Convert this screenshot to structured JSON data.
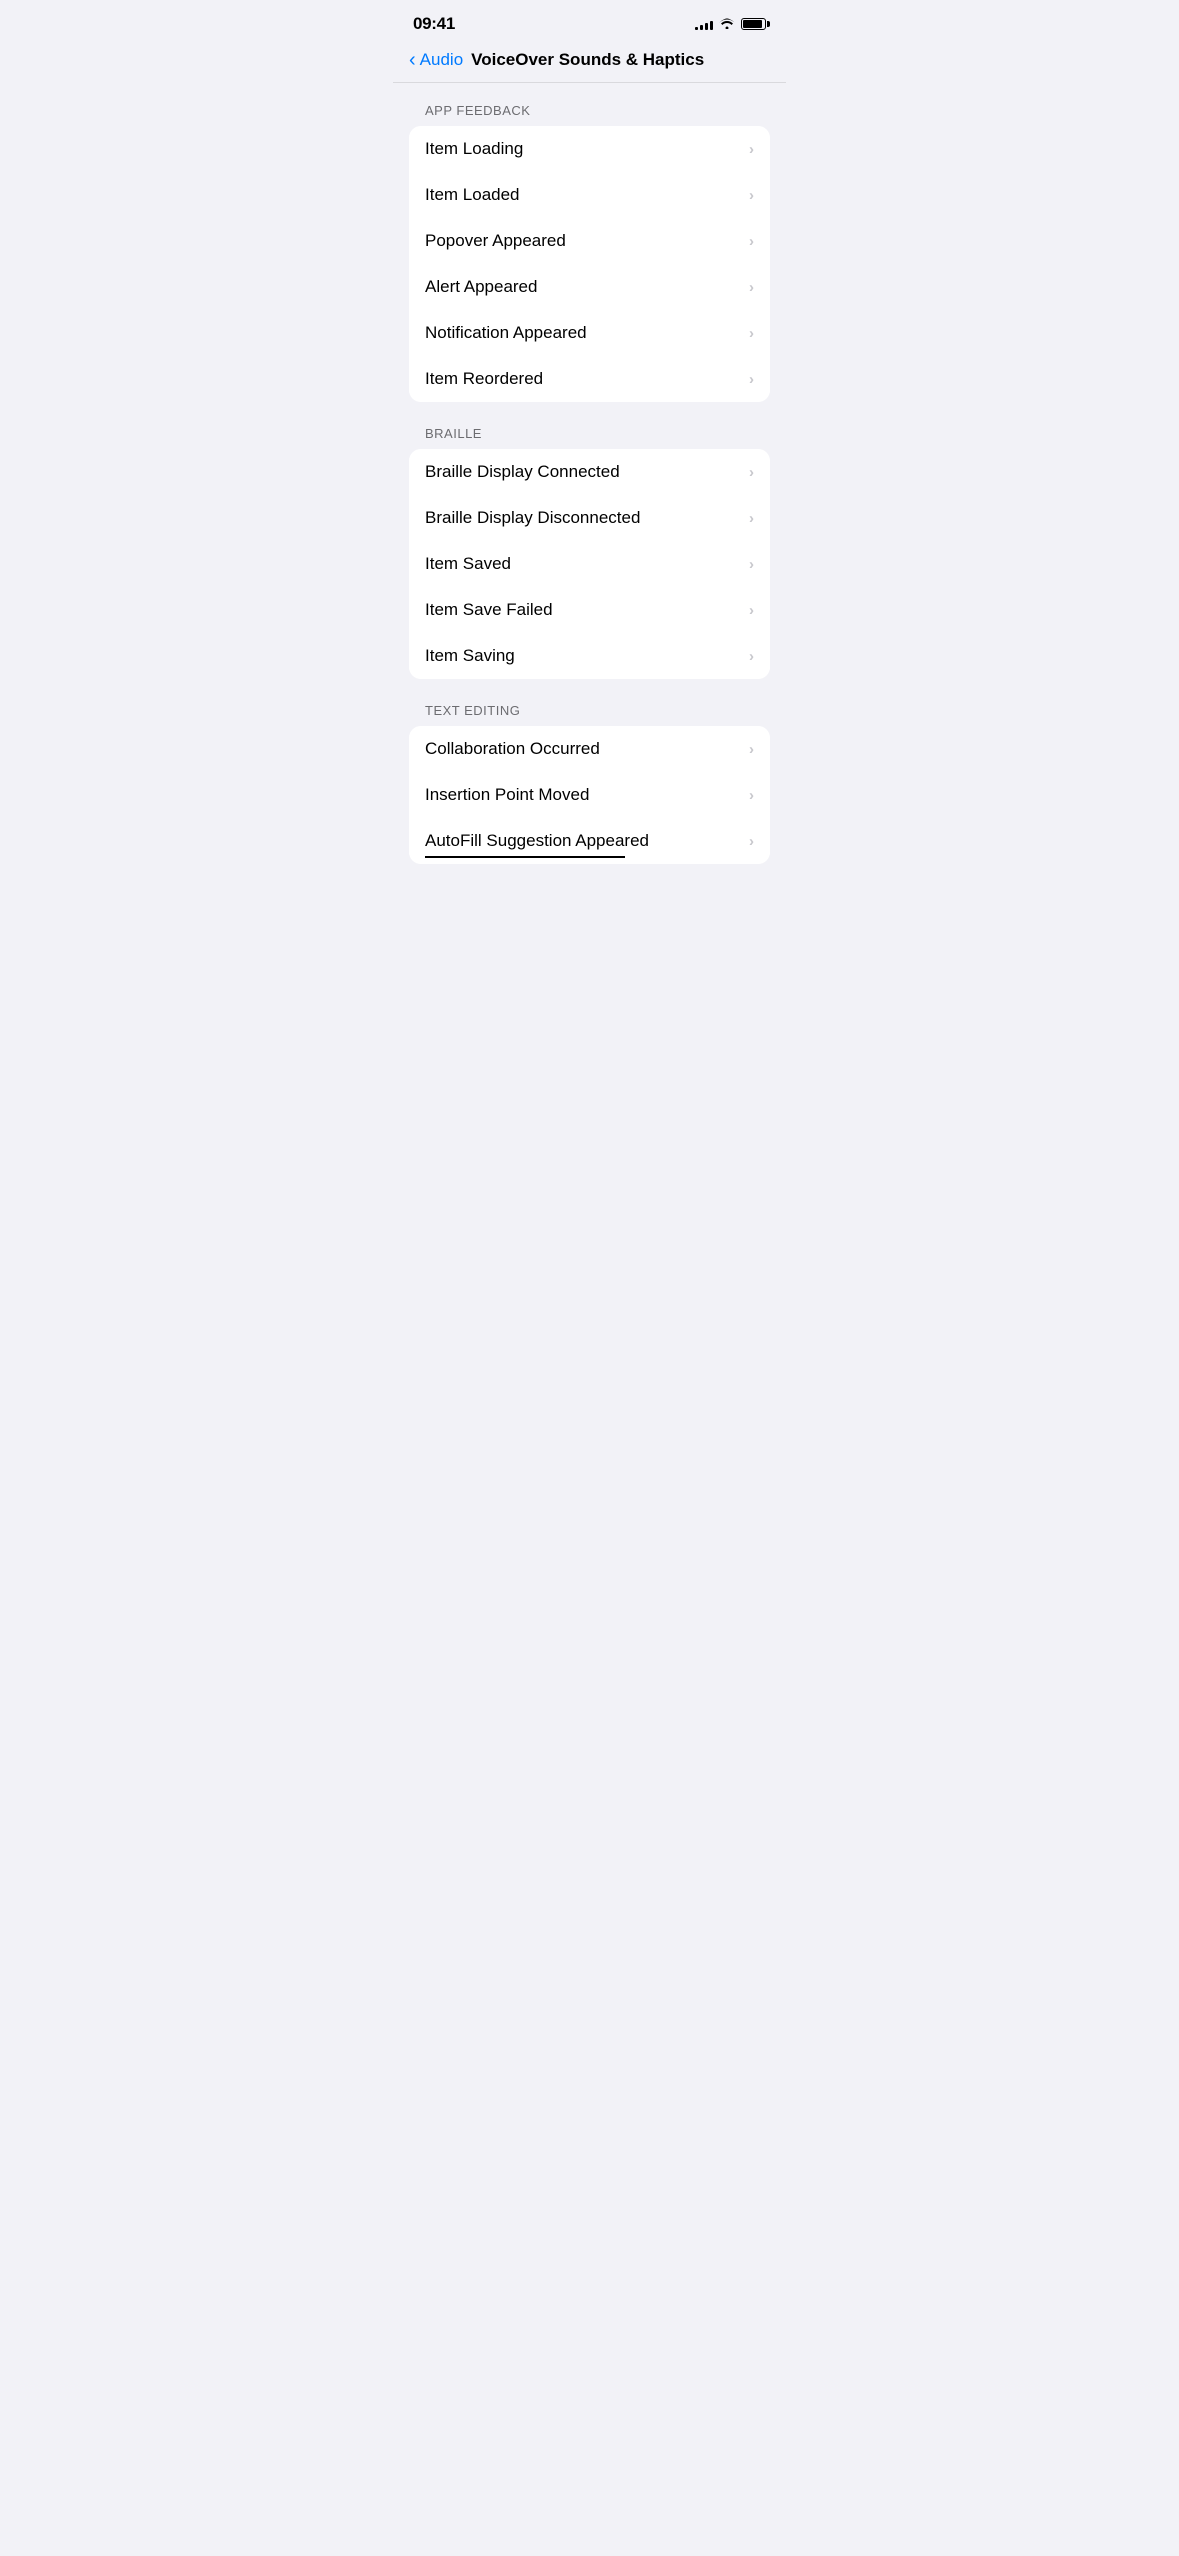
{
  "statusBar": {
    "time": "09:41",
    "signalBars": [
      3,
      5,
      7,
      9,
      11
    ],
    "wifi": "wifi",
    "battery": "battery"
  },
  "navigation": {
    "backLabel": "Audio",
    "pageTitle": "VoiceOver Sounds & Haptics"
  },
  "sections": [
    {
      "id": "app-feedback",
      "header": "APP FEEDBACK",
      "items": [
        {
          "id": "item-loading",
          "label": "Item Loading"
        },
        {
          "id": "item-loaded",
          "label": "Item Loaded"
        },
        {
          "id": "popover-appeared",
          "label": "Popover Appeared"
        },
        {
          "id": "alert-appeared",
          "label": "Alert Appeared"
        },
        {
          "id": "notification-appeared",
          "label": "Notification Appeared"
        },
        {
          "id": "item-reordered",
          "label": "Item Reordered"
        }
      ]
    },
    {
      "id": "braille",
      "header": "BRAILLE",
      "items": [
        {
          "id": "braille-display-connected",
          "label": "Braille Display Connected"
        },
        {
          "id": "braille-display-disconnected",
          "label": "Braille Display Disconnected"
        },
        {
          "id": "item-saved",
          "label": "Item Saved"
        },
        {
          "id": "item-save-failed",
          "label": "Item Save Failed"
        },
        {
          "id": "item-saving",
          "label": "Item Saving"
        }
      ]
    },
    {
      "id": "text-editing",
      "header": "TEXT EDITING",
      "items": [
        {
          "id": "collaboration-occurred",
          "label": "Collaboration Occurred"
        },
        {
          "id": "insertion-point-moved",
          "label": "Insertion Point Moved"
        },
        {
          "id": "autofill-suggestion-appeared",
          "label": "AutoFill Suggestion Appeared",
          "hasUnderline": true
        }
      ]
    }
  ]
}
